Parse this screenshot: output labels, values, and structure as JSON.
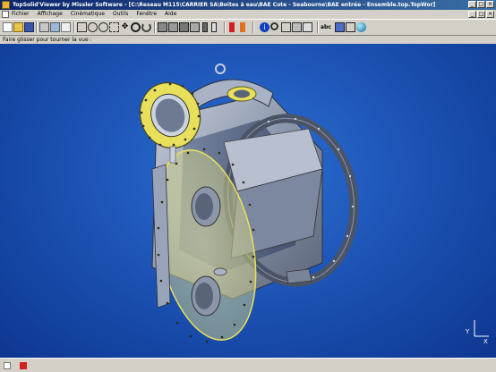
{
  "window": {
    "title": "TopSolid'Viewer by Missler Software - [C:\\Reseau M115\\CARRIER SA\\Boites à eau\\BAE Cote - Seabourne\\BAE entrée - Ensemble.top.TopWor]",
    "controls": [
      "_",
      "□",
      "×"
    ]
  },
  "menu": {
    "items": [
      "Fichier",
      "Affichage",
      "Cinématique",
      "Outils",
      "Fenêtre",
      "Aide"
    ],
    "doc_controls": [
      "_",
      "□",
      "×"
    ]
  },
  "toolbar": {
    "icons": [
      "new-icon",
      "open-icon",
      "save-icon",
      "print-icon",
      "undo-icon",
      "redo-icon",
      "copy-icon",
      "zoom-all-icon",
      "zoom-in-icon",
      "zoom-out-icon",
      "zoom-window-icon",
      "pan-icon",
      "rotate-icon",
      "top-view-icon",
      "front-view-icon",
      "side-view-icon",
      "iso-view-icon",
      "section-icon",
      "measure-icon",
      "red-marker-icon",
      "info-icon",
      "search-icon",
      "explode-icon",
      "hide-icon",
      "show-icon",
      "abc-text-icon",
      "shading-icon",
      "wire-icon",
      "sphere-icon"
    ]
  },
  "hint": {
    "text": "Faire glisser pour tourner la vue :"
  },
  "viewport": {
    "background": "#1a4fb0",
    "triad": {
      "x_label": "X",
      "y_label": "Y"
    }
  },
  "colors": {
    "flange_yellow": "#e8e05a",
    "steel": "#9aa4b8",
    "dark_ring": "#4a5466"
  }
}
